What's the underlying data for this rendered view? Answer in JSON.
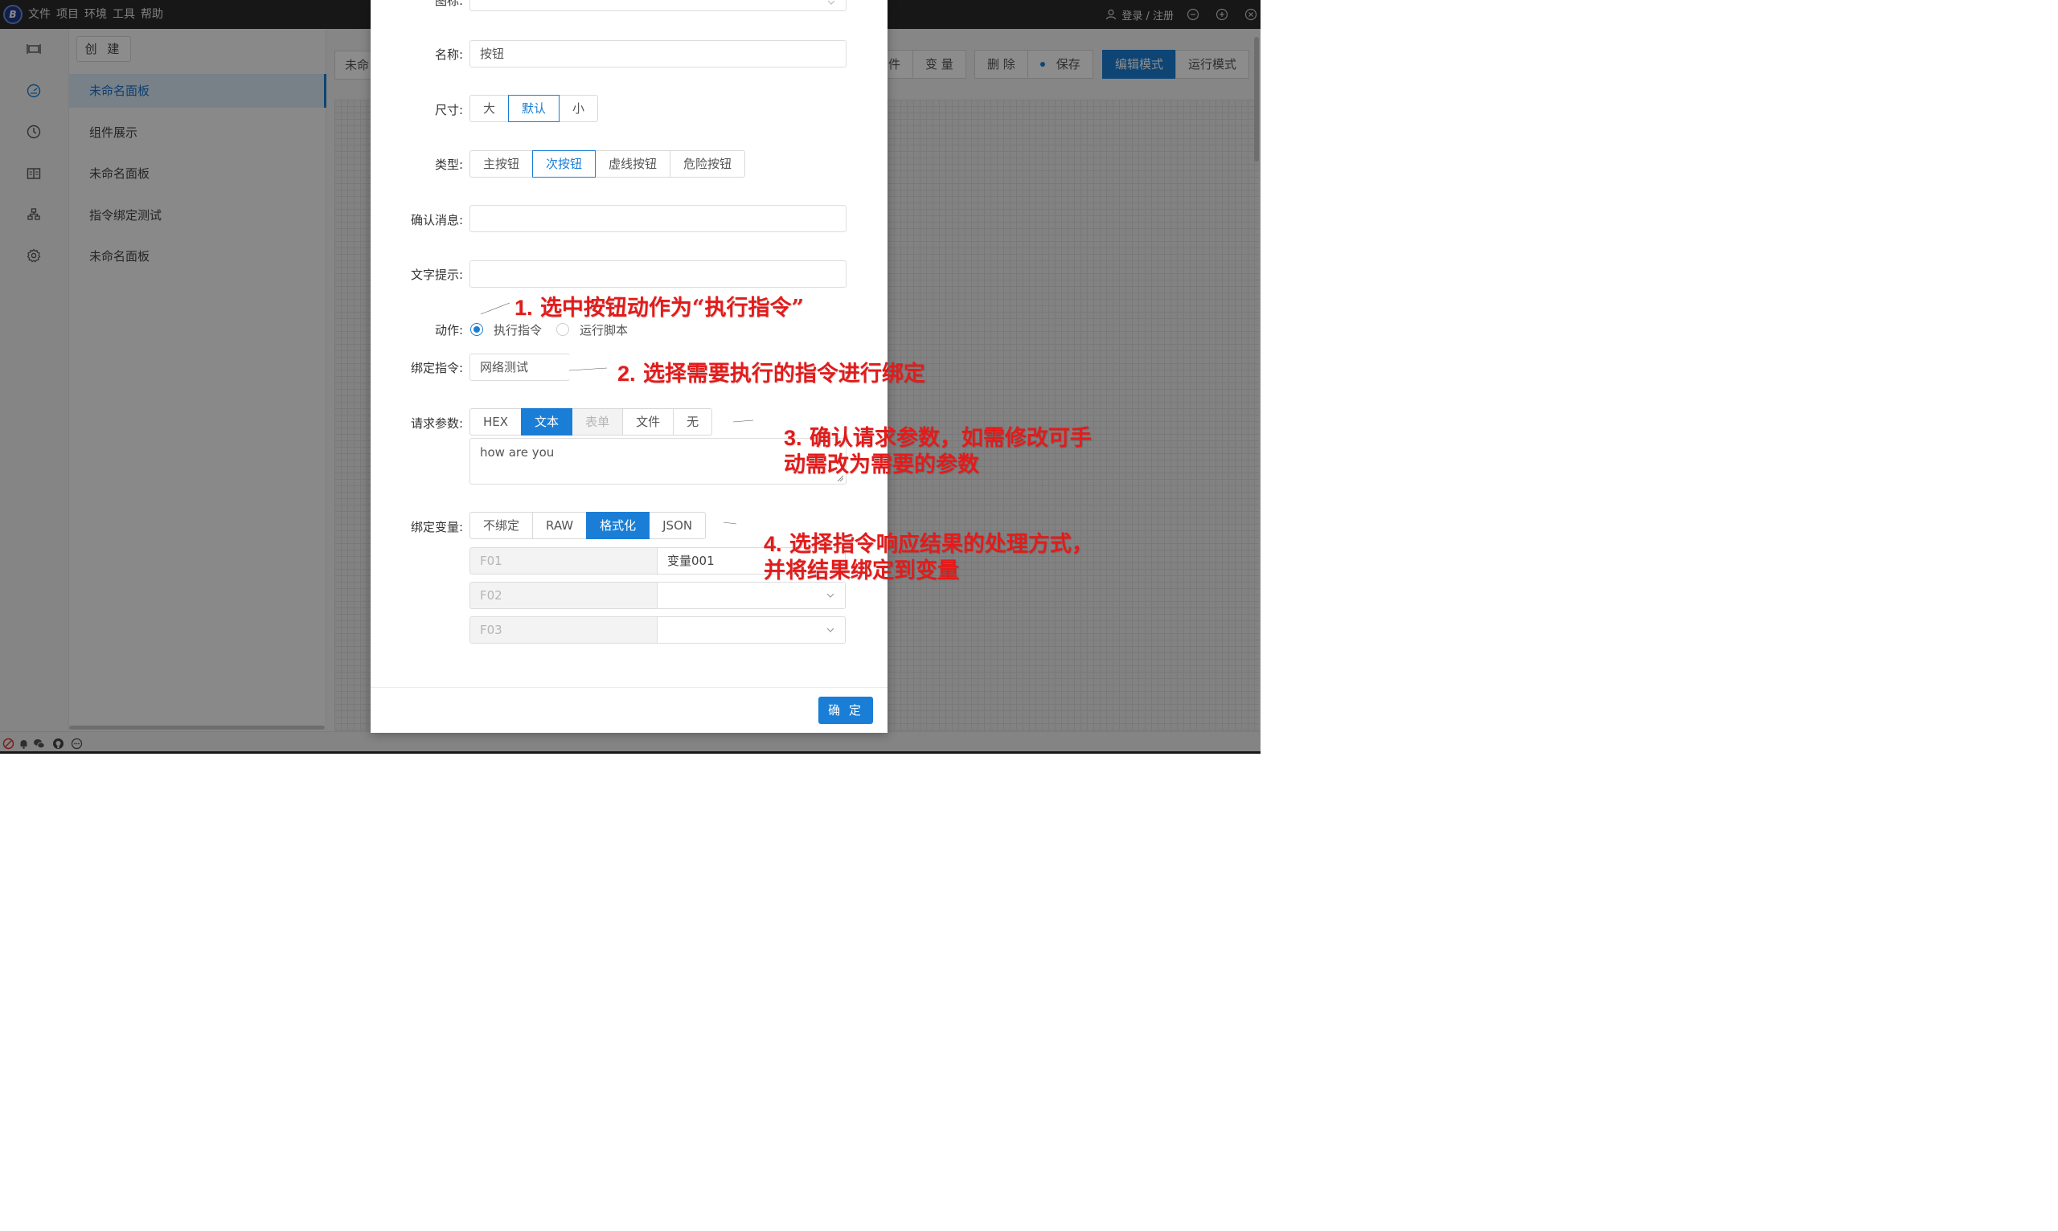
{
  "titlebar": {
    "logo_text": "B",
    "menu": [
      "文件",
      "项目",
      "环境",
      "工具",
      "帮助"
    ],
    "login": "登录 / 注册"
  },
  "sidebar": {
    "create_label": "创 建",
    "items": [
      "未命名面板",
      "组件展示",
      "未命名面板",
      "指令绑定测试",
      "未命名面板"
    ],
    "active_index": 0
  },
  "main": {
    "tab_name": "未命",
    "toolbar": {
      "component_partial": "件",
      "variable": "变 量",
      "delete": "删 除",
      "save": "保存",
      "edit_mode": "编辑模式",
      "run_mode": "运行模式"
    }
  },
  "modal": {
    "icon_label": "图标:",
    "name_label": "名称:",
    "name_value": "按钮",
    "size_label": "尺寸:",
    "size_options": [
      "大",
      "默认",
      "小"
    ],
    "size_selected": "默认",
    "type_label": "类型:",
    "type_options": [
      "主按钮",
      "次按钮",
      "虚线按钮",
      "危险按钮"
    ],
    "type_selected": "次按钮",
    "confirm_label": "确认消息:",
    "confirm_value": "",
    "tooltip_label": "文字提示:",
    "tooltip_value": "",
    "action_label": "动作:",
    "action_options": [
      "执行指令",
      "运行脚本"
    ],
    "action_selected": "执行指令",
    "bind_cmd_label": "绑定指令:",
    "bind_cmd_value": "网络测试",
    "params_label": "请求参数:",
    "params_options": [
      "HEX",
      "文本",
      "表单",
      "文件",
      "无"
    ],
    "params_selected": "文本",
    "params_disabled": "表单",
    "params_text": "how are you",
    "bind_var_label": "绑定变量:",
    "bind_var_options": [
      "不绑定",
      "RAW",
      "格式化",
      "JSON"
    ],
    "bind_var_selected": "格式化",
    "var_rows": [
      {
        "key": "F01",
        "value": "变量001"
      },
      {
        "key": "F02",
        "value": ""
      },
      {
        "key": "F03",
        "value": ""
      }
    ],
    "ok_label": "确 定"
  },
  "annotations": [
    {
      "num": "1.",
      "text": "选中按钮动作为“执行指令”"
    },
    {
      "num": "2.",
      "text": "选择需要执行的指令进行绑定"
    },
    {
      "num": "3.",
      "text": "确认请求参数，如需修改可手",
      "line2": "动需改为需要的参数"
    },
    {
      "num": "4.",
      "text": "选择指令响应结果的处理方式，",
      "line2": "并将结果绑定到变量"
    }
  ],
  "colors": {
    "accent": "#1a7ed6",
    "annotation": "#e31b1b",
    "titlebar": "#2b2b2b"
  }
}
